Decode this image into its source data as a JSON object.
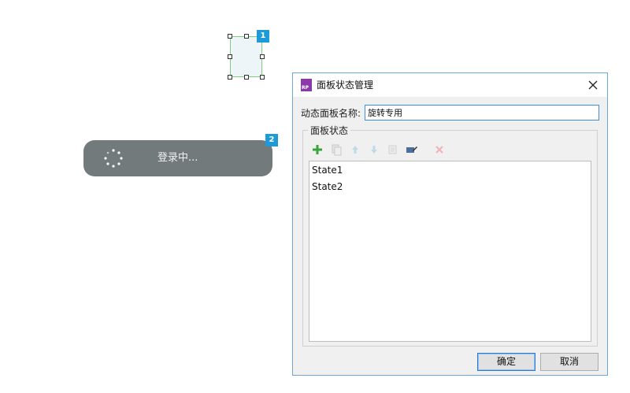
{
  "canvas": {
    "badge1": "1",
    "badge2": "2",
    "loading_text": "登录中...",
    "badge_color": "#1e9bd7",
    "pill_color": "#737a7c"
  },
  "dialog": {
    "title": "面板状态管理",
    "app_icon_text": "RP",
    "name_label": "动态面板名称:",
    "name_value": "旋转专用",
    "group_label": "面板状态",
    "toolbar_icons": [
      "add-icon",
      "duplicate-icon",
      "move-up-icon",
      "move-down-icon",
      "edit-icon",
      "edit-all-icon",
      "delete-icon"
    ],
    "states": [
      "State1",
      "State2"
    ],
    "ok_label": "确定",
    "cancel_label": "取消",
    "accent": "#3c8fd6"
  }
}
